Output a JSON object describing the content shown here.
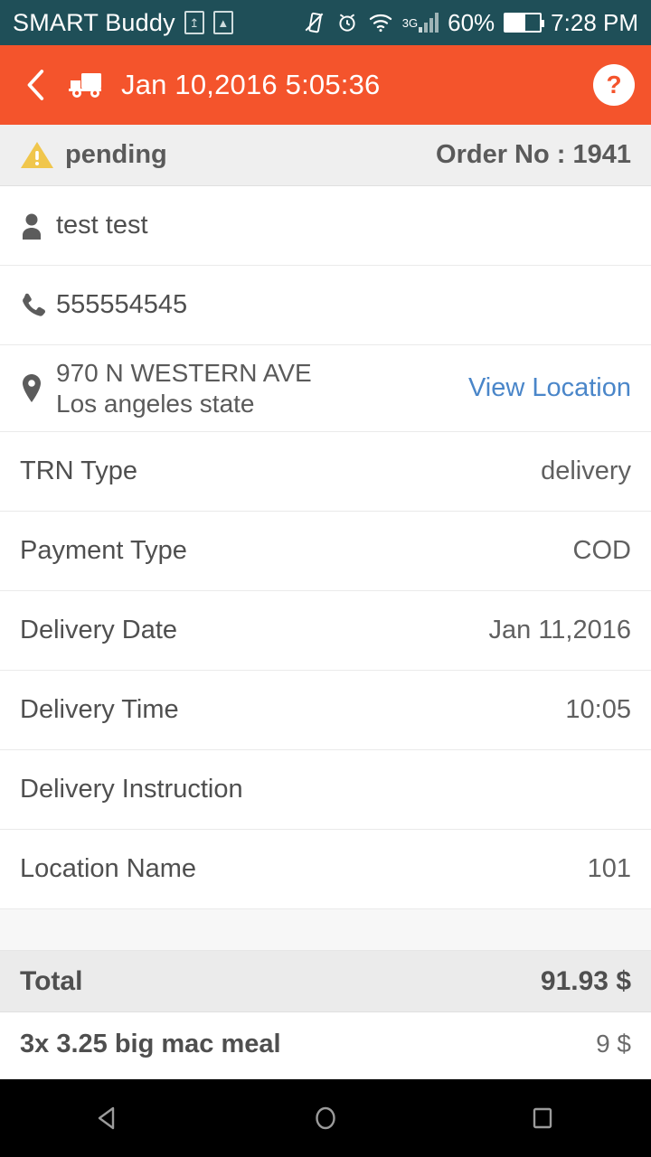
{
  "status_bar": {
    "carrier": "SMART Buddy",
    "sim_icon": "sim-card-icon",
    "screenshot_icon": "image-icon",
    "vibrate_icon": "vibrate-icon",
    "alarm_icon": "alarm-icon",
    "wifi_icon": "wifi-icon",
    "network_label": "3G",
    "signal_icon": "signal-bars-icon",
    "battery_percent": "60%",
    "battery_icon": "battery-icon",
    "time": "7:28 PM"
  },
  "app_bar": {
    "back_icon": "back-chevron-icon",
    "truck_icon": "delivery-truck-icon",
    "title": "Jan 10,2016 5:05:36",
    "help_label": "?",
    "accent_color": "#f4542c"
  },
  "status_strip": {
    "warning_icon": "warning-triangle-icon",
    "status": "pending",
    "order_label": "Order No : 1941",
    "warning_color": "#f0c64c"
  },
  "details": {
    "customer": {
      "icon": "person-icon",
      "name": "test test"
    },
    "phone": {
      "icon": "phone-icon",
      "number": "555554545"
    },
    "address": {
      "icon": "location-pin-icon",
      "line1": "970 N WESTERN AVE",
      "line2": "Los angeles state",
      "action_label": "View Location",
      "link_color": "#4a86c9"
    },
    "fields": [
      {
        "label": "TRN Type",
        "value": "delivery"
      },
      {
        "label": "Payment Type",
        "value": "COD"
      },
      {
        "label": "Delivery Date",
        "value": "Jan 11,2016"
      },
      {
        "label": "Delivery Time",
        "value": "10:05"
      },
      {
        "label": "Delivery Instruction",
        "value": ""
      },
      {
        "label": "Location Name",
        "value": "101"
      }
    ]
  },
  "summary": {
    "total_label": "Total",
    "total_value": "91.93 $",
    "items": [
      {
        "name": "3x 3.25 big mac meal",
        "price": "9 $"
      }
    ]
  },
  "nav_bar": {
    "back_icon": "nav-back-icon",
    "home_icon": "nav-home-icon",
    "recents_icon": "nav-recents-icon"
  }
}
